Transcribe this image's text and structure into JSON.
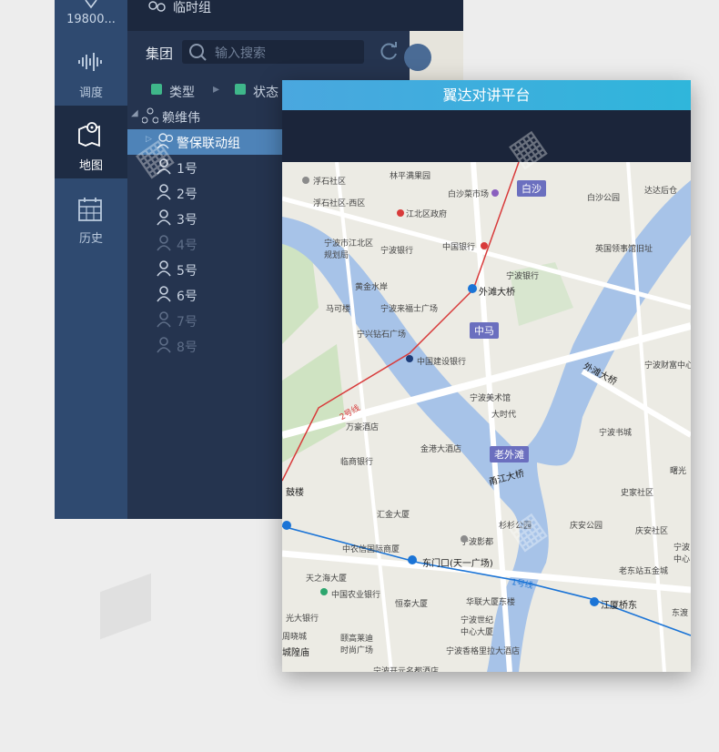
{
  "nav": {
    "user_id": "19800...",
    "items": [
      {
        "label": "调度",
        "icon": "waveform-icon"
      },
      {
        "label": "地图",
        "icon": "map-pin-icon"
      },
      {
        "label": "历史",
        "icon": "calendar-icon"
      }
    ]
  },
  "panel": {
    "temp_group": "临时组",
    "group_label": "集团",
    "search_placeholder": "输入搜索",
    "filter_type": "类型",
    "filter_status": "状态",
    "tree_root": "赖维伟",
    "selected_group": "警保联动组",
    "members": [
      "1号",
      "2号",
      "3号",
      "4号",
      "5号",
      "6号",
      "7号",
      "8号"
    ]
  },
  "front": {
    "title": "翼达对讲平台"
  },
  "map": {
    "labels": [
      "浮石社区",
      "林平满果园",
      "白沙菜市场",
      "白沙",
      "白沙公园",
      "达达后仓",
      "浮石社区-西区",
      "江北区政府",
      "宁波市江北区规划局",
      "宁波银行",
      "中国银行",
      "英国领事馆旧址",
      "宁波银行",
      "黄金水岸",
      "外滩大桥",
      "马可楼",
      "宁波来福士广场",
      "中马",
      "宁兴钻石广场",
      "中国建设银行",
      "外滩大桥",
      "宁波财富中心",
      "宁波美术馆",
      "大时代",
      "宁波书城",
      "万豪酒店",
      "金港大酒店",
      "老外滩",
      "临商银行",
      "甬江大桥",
      "曙光",
      "鼓楼",
      "汇金大厦",
      "史家社区",
      "杉杉公园",
      "庆安公园",
      "庆安社区",
      "宁波影都",
      "中农信国际商厦",
      "东门口(天一广场)",
      "宁波中心",
      "天之海大厦",
      "老东站五金城",
      "中国农业银行",
      "华联大厦东楼",
      "恒泰大厦",
      "江厦桥东",
      "东渡",
      "光大银行",
      "宁波世纪中心大厦",
      "周晓城",
      "颐高莱迪时尚广场",
      "城隍庙",
      "宁波香格里拉大酒店",
      "宁波开元名都酒店",
      "2号线",
      "1号线"
    ]
  }
}
